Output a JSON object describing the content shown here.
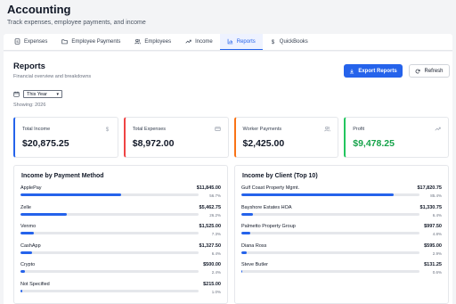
{
  "header": {
    "title": "Accounting",
    "subtitle": "Track expenses, employee payments, and income"
  },
  "tabs": [
    {
      "label": "Expenses",
      "icon": "dollar-doc-icon",
      "active": false
    },
    {
      "label": "Employee Payments",
      "icon": "folder-icon",
      "active": false
    },
    {
      "label": "Employees",
      "icon": "users-icon",
      "active": false
    },
    {
      "label": "Income",
      "icon": "trend-up-icon",
      "active": false
    },
    {
      "label": "Reports",
      "icon": "bar-chart-icon",
      "active": true
    },
    {
      "label": "QuickBooks",
      "icon": "dollar-icon",
      "active": false
    }
  ],
  "reports": {
    "title": "Reports",
    "subtitle": "Financial overview and breakdowns",
    "export_label": "Export Reports",
    "refresh_label": "Refresh",
    "period_value": "This Year",
    "showing": "Showing: 2026"
  },
  "cards": [
    {
      "label": "Total Income",
      "value": "$20,875.25",
      "accent": "#2563eb",
      "value_color": "#111827",
      "icon": "dollar-sign-icon"
    },
    {
      "label": "Total Expenses",
      "value": "$8,972.00",
      "accent": "#ef4444",
      "value_color": "#111827",
      "icon": "credit-card-icon"
    },
    {
      "label": "Worker Payments",
      "value": "$2,425.00",
      "accent": "#f97316",
      "value_color": "#111827",
      "icon": "users-icon"
    },
    {
      "label": "Profit",
      "value": "$9,478.25",
      "accent": "#22c55e",
      "value_color": "#16a34a",
      "icon": "trend-up-icon"
    }
  ],
  "by_method": {
    "title": "Income by Payment Method",
    "rows": [
      {
        "name": "ApplePay",
        "amount": "$11,845.00",
        "pct": "56.7%",
        "fraction": 0.567
      },
      {
        "name": "Zelle",
        "amount": "$5,462.75",
        "pct": "26.2%",
        "fraction": 0.262
      },
      {
        "name": "Venmo",
        "amount": "$1,525.00",
        "pct": "7.3%",
        "fraction": 0.073
      },
      {
        "name": "CashApp",
        "amount": "$1,327.50",
        "pct": "6.4%",
        "fraction": 0.064
      },
      {
        "name": "Crypto",
        "amount": "$500.00",
        "pct": "2.4%",
        "fraction": 0.024
      },
      {
        "name": "Not Specified",
        "amount": "$215.00",
        "pct": "1.0%",
        "fraction": 0.01
      }
    ]
  },
  "by_client": {
    "title": "Income by Client (Top 10)",
    "rows": [
      {
        "name": "Gulf Coast Property Mgmt.",
        "amount": "$17,820.75",
        "pct": "85.4%",
        "fraction": 0.854
      },
      {
        "name": "Bayshore Estates HOA",
        "amount": "$1,330.75",
        "pct": "6.4%",
        "fraction": 0.064
      },
      {
        "name": "Palmetto Property Group",
        "amount": "$997.50",
        "pct": "4.8%",
        "fraction": 0.048
      },
      {
        "name": "Diana Ross",
        "amount": "$595.00",
        "pct": "2.9%",
        "fraction": 0.029
      },
      {
        "name": "Steve Butler",
        "amount": "$131.25",
        "pct": "0.6%",
        "fraction": 0.006
      }
    ]
  }
}
